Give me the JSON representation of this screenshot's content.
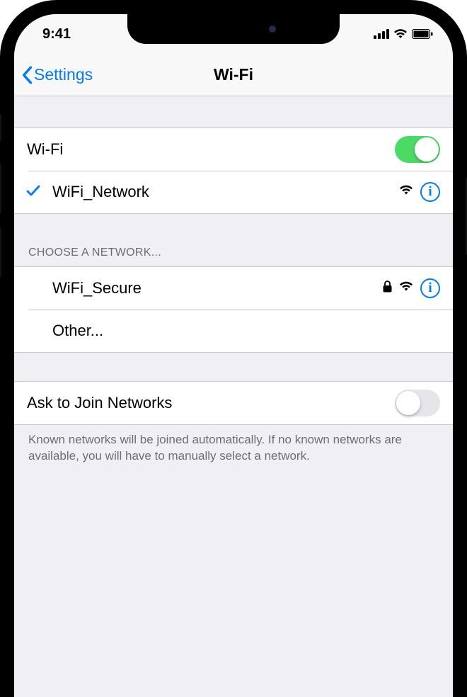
{
  "status": {
    "time": "9:41"
  },
  "nav": {
    "back_label": "Settings",
    "title": "Wi-Fi"
  },
  "wifi": {
    "toggle_label": "Wi-Fi",
    "toggle_on": true,
    "connected_network": "WiFi_Network"
  },
  "choose_header": "CHOOSE A NETWORK...",
  "networks": [
    {
      "name": "WiFi_Secure",
      "secured": true
    }
  ],
  "other_label": "Other...",
  "ask_join": {
    "label": "Ask to Join Networks",
    "on": false,
    "footer": "Known networks will be joined automatically. If no known networks are available, you will have to manually select a network."
  }
}
